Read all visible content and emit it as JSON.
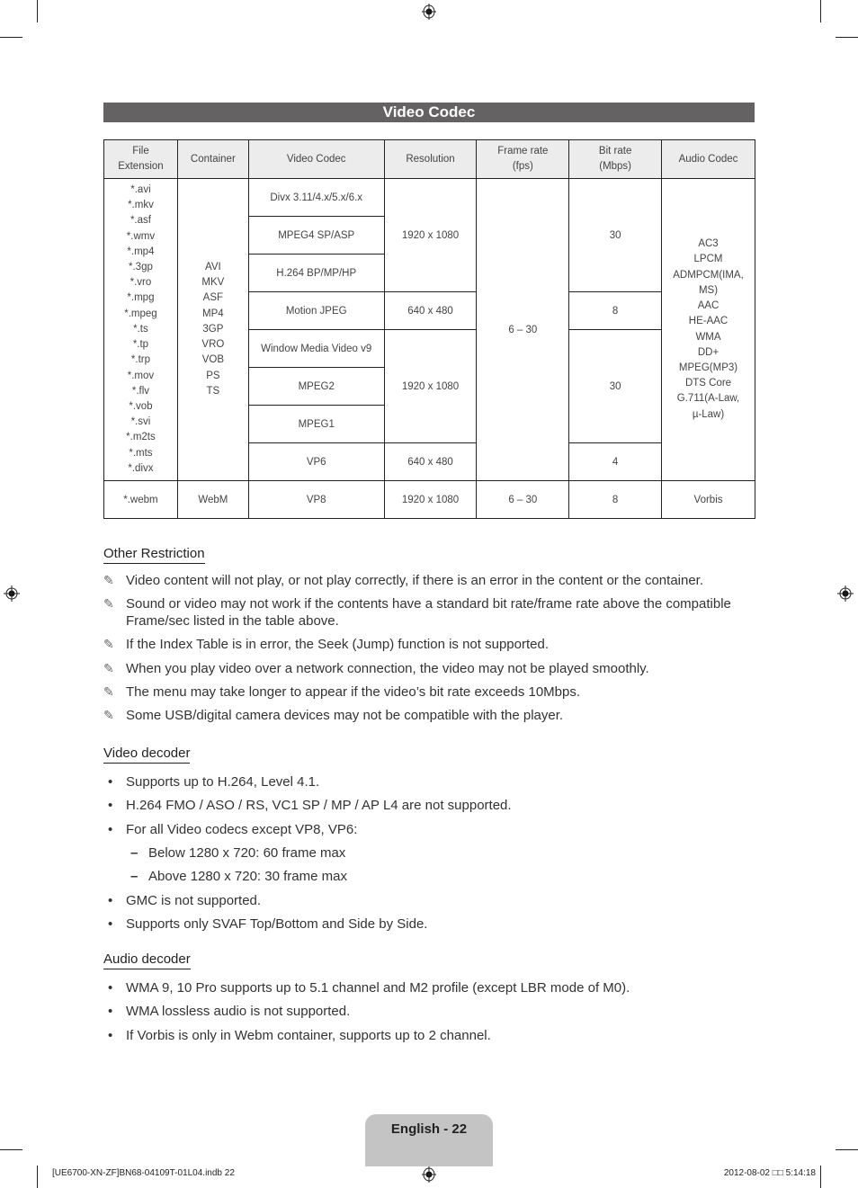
{
  "section_banner": "Video Codec",
  "table": {
    "headers": [
      "File Extension",
      "Container",
      "Video Codec",
      "Resolution",
      "Frame rate (fps)",
      "Bit rate (Mbps)",
      "Audio Codec"
    ],
    "header_lines": {
      "file_ext": [
        "File",
        "Extension"
      ],
      "frame_rate": [
        "Frame rate",
        "(fps)"
      ],
      "bit_rate": [
        "Bit rate",
        "(Mbps)"
      ]
    },
    "group1": {
      "extensions": [
        "*.avi",
        "*.mkv",
        "*.asf",
        "*.wmv",
        "*.mp4",
        "*.3gp",
        "*.vro",
        "*.mpg",
        "*.mpeg",
        "*.ts",
        "*.tp",
        "*.trp",
        "*.mov",
        "*.flv",
        "*.vob",
        "*.svi",
        "*.m2ts",
        "*.mts",
        "*.divx"
      ],
      "containers": [
        "AVI",
        "MKV",
        "ASF",
        "MP4",
        "3GP",
        "VRO",
        "VOB",
        "PS",
        "TS"
      ],
      "codecs": [
        "Divx 3.11/4.x/5.x/6.x",
        "MPEG4 SP/ASP",
        "H.264 BP/MP/HP",
        "Motion JPEG",
        "Window Media Video v9",
        "MPEG2",
        "MPEG1",
        "VP6"
      ],
      "resolutions": [
        "1920 x 1080",
        "640 x 480",
        "1920 x 1080",
        "640 x 480"
      ],
      "frame_rate": "6 – 30",
      "bit_rates": [
        "30",
        "8",
        "30",
        "4"
      ],
      "audio_codecs": [
        "AC3",
        "LPCM",
        "ADMPCM(IMA, MS)",
        "AAC",
        "HE-AAC",
        "WMA",
        "DD+",
        "MPEG(MP3)",
        "DTS Core",
        "G.711(A-Law,",
        "µ-Law)"
      ]
    },
    "webm_row": {
      "extension": "*.webm",
      "container": "WebM",
      "codec": "VP8",
      "resolution": "1920 x 1080",
      "frame_rate": "6 – 30",
      "bit_rate": "8",
      "audio": "Vorbis"
    }
  },
  "other_restriction": {
    "title": "Other Restriction",
    "notes": [
      "Video content will not play, or not play correctly, if there is an error in the content or the container.",
      "Sound or video may not work if the contents have a standard bit rate/frame rate above the compatible Frame/sec listed in the table above.",
      "If the Index Table is in error, the Seek (Jump) function is not supported.",
      "When you play video over a network connection, the video may not be played smoothly.",
      "The menu may take longer to appear if the video’s bit rate exceeds 10Mbps.",
      "Some USB/digital camera devices may not be compatible with the player."
    ],
    "note_icon": "✎"
  },
  "video_decoder": {
    "title": "Video decoder",
    "items": [
      "Supports up to H.264, Level 4.1.",
      "H.264 FMO / ASO / RS, VC1 SP / MP / AP L4 are not supported.",
      "For all Video codecs except VP8, VP6:",
      "GMC is not supported.",
      "Supports only SVAF Top/Bottom and Side by Side."
    ],
    "subitems": [
      "Below 1280 x 720: 60 frame max",
      "Above 1280 x 720: 30 frame max"
    ]
  },
  "audio_decoder": {
    "title": "Audio decoder",
    "items": [
      "WMA 9, 10 Pro supports up to 5.1 channel and M2 profile (except LBR mode of M0).",
      "WMA lossless audio is not supported.",
      "If Vorbis is only in Webm container, supports up to 2 channel."
    ]
  },
  "page_label": "English - 22",
  "footer": {
    "left": "[UE6700-XN-ZF]BN68-04109T-01L04.indb   22",
    "right": "2012-08-02   □□ 5:14:18"
  },
  "glyphs": {
    "bullet": "•",
    "dash": "–"
  }
}
